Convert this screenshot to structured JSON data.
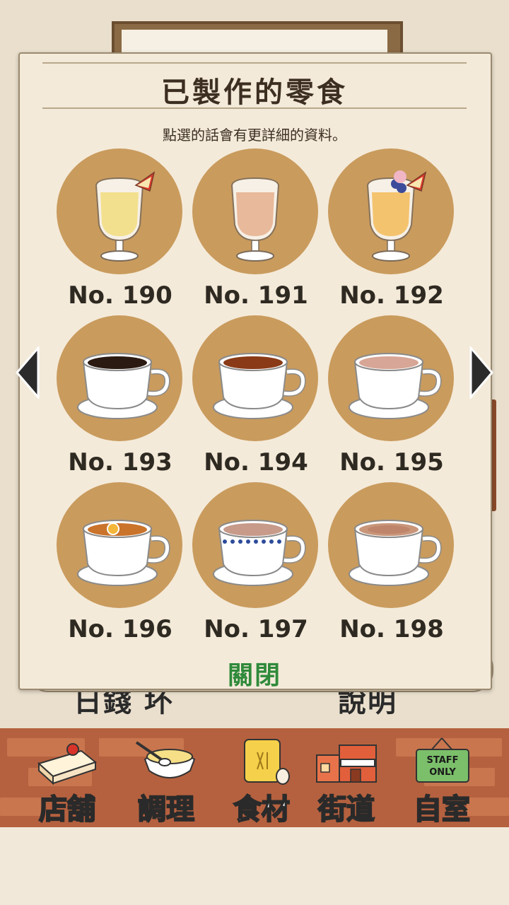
{
  "panel": {
    "title": "已製作的零食",
    "subtitle": "點選的話會有更詳細的資料。",
    "close_label": "關閉"
  },
  "items": [
    {
      "label": "No. 190",
      "kind": "goblet",
      "drink_color": "#f3e08e",
      "garnish": "apple"
    },
    {
      "label": "No. 191",
      "kind": "goblet",
      "drink_color": "#e8b99a",
      "garnish": "none"
    },
    {
      "label": "No. 192",
      "kind": "goblet",
      "drink_color": "#f4c36e",
      "garnish": "berries-apple"
    },
    {
      "label": "No. 193",
      "kind": "cup",
      "drink_color": "#2b1a12",
      "garnish": "none"
    },
    {
      "label": "No. 194",
      "kind": "cup",
      "drink_color": "#8a3a16",
      "garnish": "none"
    },
    {
      "label": "No. 195",
      "kind": "cup",
      "drink_color": "#d7a696",
      "garnish": "none"
    },
    {
      "label": "No. 196",
      "kind": "cup",
      "drink_color": "#c9732b",
      "garnish": "lemon"
    },
    {
      "label": "No. 197",
      "kind": "cup-blue",
      "drink_color": "#c79a8a",
      "garnish": "none"
    },
    {
      "label": "No. 198",
      "kind": "cup",
      "drink_color": "#c9967a",
      "garnish": "cocoa"
    }
  ],
  "background": {
    "left_text": "日錢 坏",
    "right_text": "說明"
  },
  "nav": [
    {
      "label": "店舖",
      "icon": "cake-icon"
    },
    {
      "label": "調理",
      "icon": "mixing-bowl-icon"
    },
    {
      "label": "食材",
      "icon": "flour-bag-icon"
    },
    {
      "label": "街道",
      "icon": "shop-street-icon"
    },
    {
      "label": "自室",
      "icon": "staff-only-sign-icon",
      "sign_text": "STAFF ONLY"
    }
  ]
}
